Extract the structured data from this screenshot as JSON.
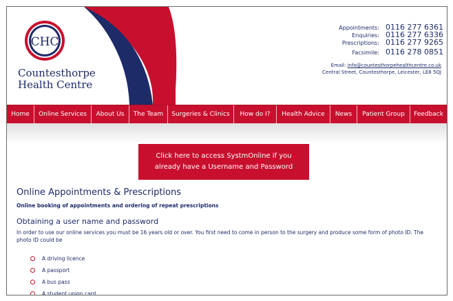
{
  "brand": {
    "logo_initials": "CHC",
    "name_line1": "Countesthorpe",
    "name_line2": "Health Centre",
    "navy": "#1d2b68",
    "red": "#c8102e"
  },
  "contacts": [
    {
      "label": "Appointments:",
      "number": "0116 277 6361"
    },
    {
      "label": "Enquiries:",
      "number": "0116 277 6336"
    },
    {
      "label": "Prescriptions:",
      "number": "0116 277 9265"
    },
    {
      "label": "Facsimile:",
      "number": "0116 278 0851"
    }
  ],
  "email_label": "Email:",
  "email": "info@countesthorpehealthcentre.co.uk",
  "address": "Central Street, Countesthorpe, Leicester, LE8 5QJ",
  "nav": [
    "Home",
    "Online Services",
    "About Us",
    "The Team",
    "Surgeries & Clinics",
    "How do I?",
    "Health Advice",
    "News",
    "Patient Group",
    "Feedback"
  ],
  "cta": "Click here to access SystmOnline if you already have a Username and Password",
  "main": {
    "title": "Online Appointments & Prescriptions",
    "subtitle": "Online booking of appointments and ordering of repeat prescriptions",
    "section_title": "Obtaining a user name and password",
    "paragraph": "In order to use our online services you must be 16 years old or over. You first need to come in person to the surgery and produce some form of photo ID. The photo ID could be",
    "id_list": [
      "A driving licence",
      "A passport",
      "A bus pass",
      "A student union card"
    ]
  }
}
